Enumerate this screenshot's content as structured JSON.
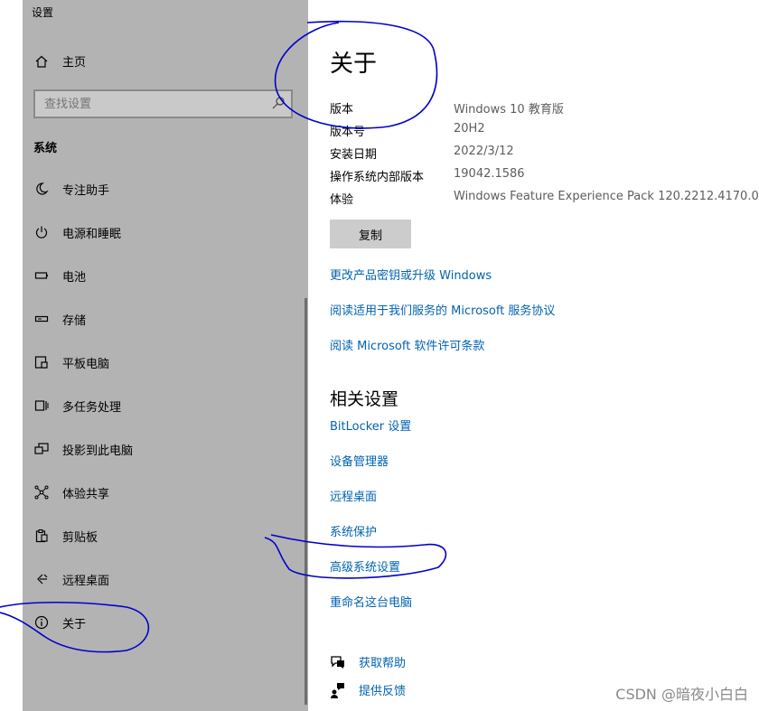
{
  "window": {
    "title": "设置"
  },
  "sidebar": {
    "home_label": "主页",
    "search_placeholder": "查找设置",
    "section_label": "系统",
    "items": [
      {
        "label": "专注助手",
        "icon": "moon-icon"
      },
      {
        "label": "电源和睡眠",
        "icon": "power-icon"
      },
      {
        "label": "电池",
        "icon": "battery-icon"
      },
      {
        "label": "存储",
        "icon": "storage-icon"
      },
      {
        "label": "平板电脑",
        "icon": "tablet-icon"
      },
      {
        "label": "多任务处理",
        "icon": "multitask-icon"
      },
      {
        "label": "投影到此电脑",
        "icon": "project-icon"
      },
      {
        "label": "体验共享",
        "icon": "share-icon"
      },
      {
        "label": "剪贴板",
        "icon": "clipboard-icon"
      },
      {
        "label": "远程桌面",
        "icon": "remote-icon"
      },
      {
        "label": "关于",
        "icon": "info-icon"
      }
    ]
  },
  "main": {
    "title": "关于",
    "specs": [
      {
        "key": "版本",
        "value": "Windows 10 教育版"
      },
      {
        "key": "版本号",
        "value": "20H2"
      },
      {
        "key": "安装日期",
        "value": "2022/3/12"
      },
      {
        "key": "操作系统内部版本",
        "value": "19042.1586"
      },
      {
        "key": "体验",
        "value": "Windows Feature Experience Pack 120.2212.4170.0"
      }
    ],
    "copy_label": "复制",
    "links": [
      "更改产品密钥或升级 Windows",
      "阅读适用于我们服务的 Microsoft 服务协议",
      "阅读 Microsoft 软件许可条款"
    ],
    "related_heading": "相关设置",
    "related_links": [
      "BitLocker 设置",
      "设备管理器",
      "远程桌面",
      "系统保护",
      "高级系统设置",
      "重命名这台电脑"
    ],
    "help": [
      {
        "label": "获取帮助",
        "icon": "help-icon"
      },
      {
        "label": "提供反馈",
        "icon": "feedback-icon"
      }
    ]
  },
  "watermark": "CSDN @暗夜小白白",
  "colors": {
    "sidebar_bg": "#b3b3b3",
    "link": "#0063b1",
    "annotation": "#0000cc"
  }
}
